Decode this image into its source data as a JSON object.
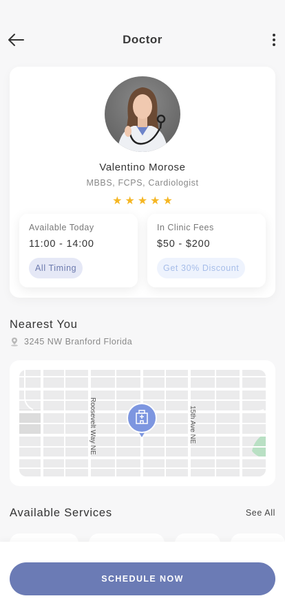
{
  "header": {
    "title": "Doctor"
  },
  "doctor": {
    "name": "Valentino Morose",
    "qualifications": "MBBS, FCPS, Cardiologist",
    "rating": 5
  },
  "availability": {
    "label": "Available Today",
    "time": "11:00 - 14:00",
    "button": "All Timing"
  },
  "fees": {
    "label": "In Clinic Fees",
    "range": "$50 - $200",
    "button": "Get 30% Discount"
  },
  "nearest": {
    "title": "Nearest You",
    "address": "3245 NW Branford Florida"
  },
  "map": {
    "streets": [
      "Roosevelt Way NE",
      "15th Ave NE"
    ]
  },
  "services": {
    "title": "Available Services",
    "see_all": "See All"
  },
  "cta": {
    "label": "SCHEDULE NOW"
  },
  "colors": {
    "accent": "#6b7bb5",
    "star": "#f5b623",
    "pill_timing_bg": "#e5e8f6",
    "pill_discount_bg": "#eef3fd",
    "map_marker": "#7d96e0"
  }
}
